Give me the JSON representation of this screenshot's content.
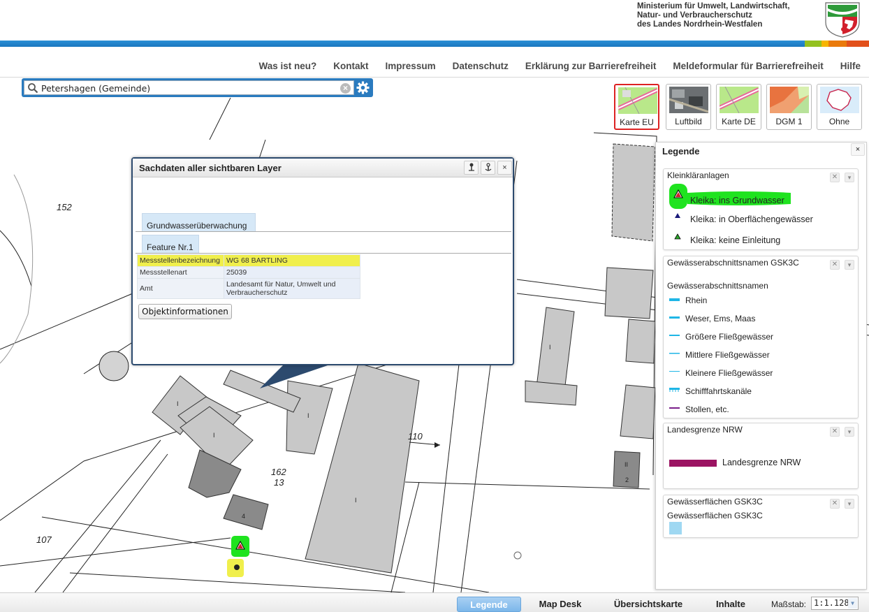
{
  "header": {
    "ministry_line1": "Ministerium für Umwelt, Landwirtschaft,",
    "ministry_line2": "Natur- und Verbraucherschutz",
    "ministry_line3": "des Landes Nordrhein-Westfalen",
    "brand_blue": "#1a77bf",
    "stripe_colors": [
      "#94c11f",
      "#f7b500",
      "#ea7a0b",
      "#e2501b"
    ]
  },
  "nav": {
    "items": [
      "Was ist neu?",
      "Kontakt",
      "Impressum",
      "Datenschutz",
      "Erklärung zur Barrierefreiheit",
      "Meldeformular für Barrierefreiheit",
      "Hilfe"
    ]
  },
  "search": {
    "value": "Petershagen (Gemeinde)",
    "clear_glyph": "×"
  },
  "basemaps": [
    {
      "label": "Karte EU",
      "active": true
    },
    {
      "label": "Luftbild",
      "active": false
    },
    {
      "label": "Karte DE",
      "active": false
    },
    {
      "label": "DGM 1",
      "active": false
    },
    {
      "label": "Ohne",
      "active": false
    }
  ],
  "map_labels": {
    "l152": "152",
    "l110": "110",
    "l162": "162",
    "l13": "13",
    "l107": "107",
    "l4": "4",
    "lII": "II",
    "l2": "2",
    "lI": "I"
  },
  "popup": {
    "title": "Sachdaten aller sichtbaren Layer",
    "close_glyph": "×",
    "tab_layer": "Grundwasserüberwachung",
    "tab_feature": "Feature Nr.1",
    "rows": [
      {
        "key": "Messstellenbezeichnung",
        "value": "WG 68 BARTLING",
        "highlight": true
      },
      {
        "key": "Messstellenart",
        "value": "25039",
        "highlight": false
      },
      {
        "key": "Amt",
        "value": "Landesamt für Natur, Umwelt und Verbraucherschutz",
        "highlight": false
      }
    ],
    "button": "Objektinformationen"
  },
  "legend": {
    "title": "Legende",
    "close_glyph": "×",
    "panels": [
      {
        "title": "Kleinkläranlagen",
        "items": [
          "Kleika: ins Grundwasser",
          "Kleika: in Oberflächengewässer",
          "Kleika: keine Einleitung"
        ]
      },
      {
        "title": "Gewässerabschnittsnamen GSK3C",
        "subtitle": "Gewässerabschnittsnamen",
        "items": [
          "Rhein",
          "Weser, Ems, Maas",
          "Größere Fließgewässer",
          "Mittlere Fließgewässer",
          "Kleinere Fließgewässer",
          "Schifffahrtskanäle",
          "Stollen, etc."
        ]
      },
      {
        "title": "Landesgrenze NRW",
        "items": [
          "Landesgrenze NRW"
        ]
      },
      {
        "title": "Gewässerflächen GSK3C",
        "subtitle": "Gewässerflächen GSK3C",
        "items": []
      }
    ],
    "colors": {
      "water": "#1fb6e6",
      "stollen": "#7a1f8a",
      "landesgrenze": "#9b1462",
      "gewaesserflaeche": "#9fd8f2",
      "highlight_green": "#1fe31f",
      "highlight_yellow": "#f0ef4c"
    }
  },
  "bottombar": {
    "tabs": [
      "Legende",
      "Map Desk",
      "Übersichtskarte",
      "Inhalte"
    ],
    "scale_label": "Maßstab:",
    "scale_value": "1:1.128"
  }
}
